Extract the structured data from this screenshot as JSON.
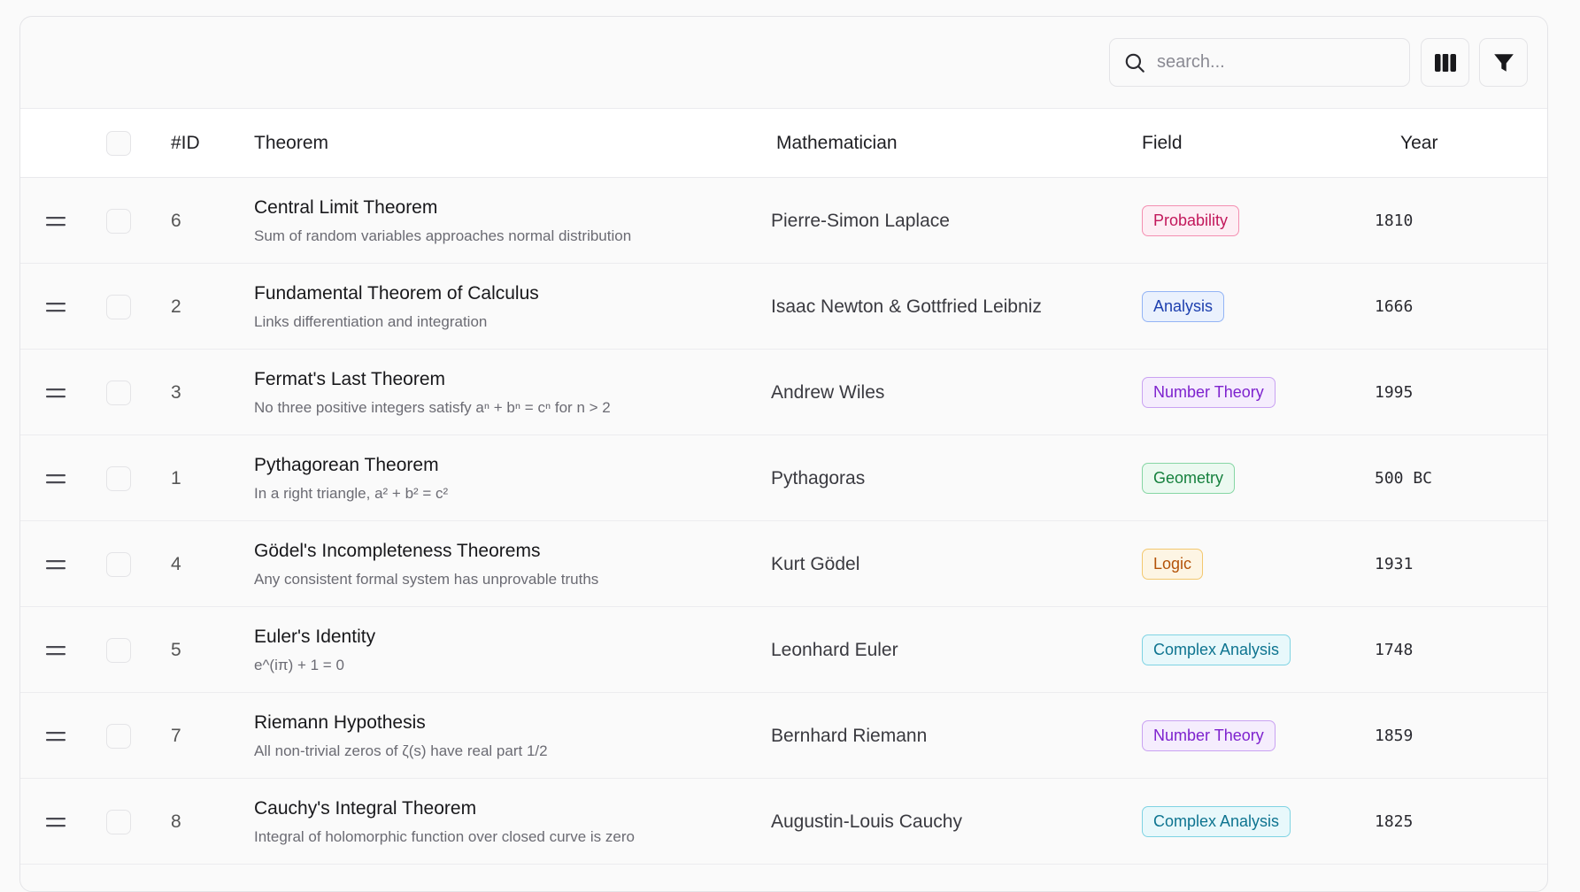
{
  "search": {
    "placeholder": "search..."
  },
  "icons": {
    "search": "search-icon",
    "columns": "columns-icon",
    "filter": "filter-icon",
    "drag": "drag-handle-icon"
  },
  "headers": {
    "id": "#ID",
    "theorem": "Theorem",
    "mathematician": "Mathematician",
    "field": "Field",
    "year": "Year"
  },
  "field_colors": {
    "Probability": {
      "text": "#c2185b",
      "bg": "#fdeef4",
      "border": "#f48fb1"
    },
    "Analysis": {
      "text": "#1e40af",
      "bg": "#eaf1fd",
      "border": "#93b4f5"
    },
    "Number Theory": {
      "text": "#7e22ce",
      "bg": "#f5edfd",
      "border": "#c9a2f2"
    },
    "Geometry": {
      "text": "#15803d",
      "bg": "#ebf9f0",
      "border": "#86d6a4"
    },
    "Logic": {
      "text": "#b45309",
      "bg": "#fdf5e4",
      "border": "#f3c86f"
    },
    "Complex Analysis": {
      "text": "#0e7490",
      "bg": "#e8f8fb",
      "border": "#7fd3e3"
    }
  },
  "rows": [
    {
      "id": "6",
      "title": "Central Limit Theorem",
      "desc": "Sum of random variables approaches normal distribution",
      "mathematician": "Pierre-Simon Laplace",
      "field": "Probability",
      "year": "1810"
    },
    {
      "id": "2",
      "title": "Fundamental Theorem of Calculus",
      "desc": "Links differentiation and integration",
      "mathematician": "Isaac Newton & Gottfried Leibniz",
      "field": "Analysis",
      "year": "1666"
    },
    {
      "id": "3",
      "title": "Fermat's Last Theorem",
      "desc": "No three positive integers satisfy aⁿ + bⁿ = cⁿ for n > 2",
      "mathematician": "Andrew Wiles",
      "field": "Number Theory",
      "year": "1995"
    },
    {
      "id": "1",
      "title": "Pythagorean Theorem",
      "desc": "In a right triangle, a² + b² = c²",
      "mathematician": "Pythagoras",
      "field": "Geometry",
      "year": "500 BC"
    },
    {
      "id": "4",
      "title": "Gödel's Incompleteness Theorems",
      "desc": "Any consistent formal system has unprovable truths",
      "mathematician": "Kurt Gödel",
      "field": "Logic",
      "year": "1931"
    },
    {
      "id": "5",
      "title": "Euler's Identity",
      "desc": "e^(iπ) + 1 = 0",
      "mathematician": "Leonhard Euler",
      "field": "Complex Analysis",
      "year": "1748"
    },
    {
      "id": "7",
      "title": "Riemann Hypothesis",
      "desc": "All non-trivial zeros of ζ(s) have real part 1/2",
      "mathematician": "Bernhard Riemann",
      "field": "Number Theory",
      "year": "1859"
    },
    {
      "id": "8",
      "title": "Cauchy's Integral Theorem",
      "desc": "Integral of holomorphic function over closed curve is zero",
      "mathematician": "Augustin-Louis Cauchy",
      "field": "Complex Analysis",
      "year": "1825"
    }
  ]
}
